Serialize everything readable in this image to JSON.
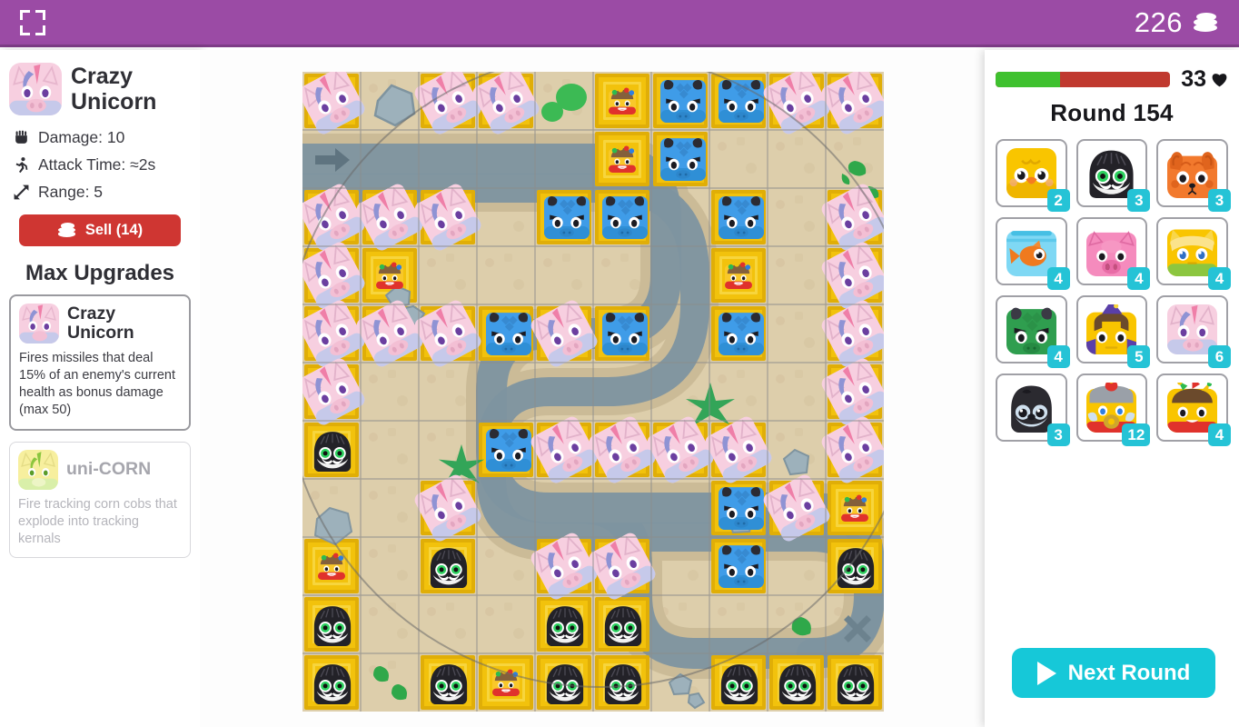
{
  "topbar": {
    "coins": "226",
    "coin_icon": "coin-stack-icon",
    "fullscreen_icon": "fullscreen-icon"
  },
  "selected_tower": {
    "name": "Crazy Unicorn",
    "portrait_icon": "unicorn-portrait-icon",
    "stats": [
      {
        "icon": "fist-icon",
        "label": "Damage: 10"
      },
      {
        "icon": "runner-icon",
        "label": "Attack Time: ≈2s"
      },
      {
        "icon": "arrows-expand-icon",
        "label": "Range: 5"
      }
    ],
    "sell_label": "Sell (14)"
  },
  "upgrades": {
    "title": "Max Upgrades",
    "items": [
      {
        "name": "Crazy Unicorn",
        "desc": "Fires missiles that deal 15% of an enemy's current health as bonus damage (max 50)",
        "icon": "unicorn-upgrade-icon",
        "locked": false
      },
      {
        "name": "uni-CORN",
        "desc": "Fire tracking corn cobs that explode into tracking kernals",
        "icon": "unicorn-corn-icon",
        "locked": true
      }
    ]
  },
  "status": {
    "health_value": "33",
    "health_percent": 37,
    "heart_icon": "heart-icon",
    "round_label": "Round 154"
  },
  "shop": {
    "towers": [
      {
        "name": "chick",
        "cost": "2",
        "icon": "chick-icon"
      },
      {
        "name": "owl",
        "cost": "3",
        "icon": "owl-icon"
      },
      {
        "name": "squirrel",
        "cost": "3",
        "icon": "squirrel-icon"
      },
      {
        "name": "goldfish",
        "cost": "4",
        "icon": "goldfish-icon"
      },
      {
        "name": "pig",
        "cost": "4",
        "icon": "pig-icon"
      },
      {
        "name": "cat",
        "cost": "4",
        "icon": "cat-icon"
      },
      {
        "name": "dragon",
        "cost": "4",
        "icon": "dragon-icon"
      },
      {
        "name": "wizard",
        "cost": "5",
        "icon": "wizard-icon"
      },
      {
        "name": "unicorn",
        "cost": "6",
        "icon": "unicorn-icon"
      },
      {
        "name": "penguin",
        "cost": "3",
        "icon": "penguin-icon"
      },
      {
        "name": "king",
        "cost": "12",
        "icon": "king-icon"
      },
      {
        "name": "jester",
        "cost": "4",
        "icon": "jester-icon"
      }
    ]
  },
  "controls": {
    "next_round_label": "Next Round",
    "play_icon": "play-icon"
  },
  "colors": {
    "header": "#9b4ba5",
    "accent_cyan": "#16c8d8",
    "sell_red": "#cf3632",
    "hp_green": "#3fc12f",
    "hp_red": "#c0392f",
    "plot_gold": "#f2c20c"
  },
  "board": {
    "cols": 10,
    "rows": 11,
    "cell_size": 64,
    "arrow_icon": "entrance-arrow-icon",
    "exit_icon": "exit-x-icon",
    "range_indicator": true,
    "grid": [
      [
        "unicorn",
        "",
        "unicorn",
        "unicorn",
        "",
        "clown",
        "dragon",
        "dragon",
        "unicorn",
        "unicorn"
      ],
      [
        "",
        "",
        "",
        "",
        "",
        "clown",
        "dragon",
        "",
        "",
        ""
      ],
      [
        "unicorn",
        "unicorn",
        "unicorn",
        "",
        "dragon",
        "dragon",
        "",
        "dragon",
        "",
        "unicorn"
      ],
      [
        "unicorn",
        "clown",
        "",
        "",
        "",
        "",
        "",
        "clown",
        "",
        "unicorn"
      ],
      [
        "unicorn",
        "unicorn",
        "unicorn",
        "dragon",
        "unicorn",
        "dragon",
        "",
        "dragon",
        "",
        "unicorn"
      ],
      [
        "unicorn",
        "",
        "",
        "",
        "",
        "",
        "",
        "",
        "",
        "unicorn"
      ],
      [
        "owl",
        "",
        "",
        "dragon",
        "unicorn",
        "unicorn",
        "unicorn",
        "unicorn",
        "",
        "unicorn"
      ],
      [
        "",
        "",
        "unicorn",
        "",
        "",
        "",
        "",
        "dragon",
        "unicorn",
        "clown"
      ],
      [
        "clown",
        "",
        "owl",
        "",
        "unicorn",
        "unicorn",
        "",
        "dragon",
        "",
        "owl"
      ],
      [
        "owl",
        "",
        "",
        "",
        "owl",
        "owl",
        "",
        "",
        "",
        ""
      ],
      [
        "owl",
        "",
        "owl",
        "clown",
        "owl",
        "owl",
        "",
        "owl",
        "owl",
        "owl"
      ]
    ]
  }
}
